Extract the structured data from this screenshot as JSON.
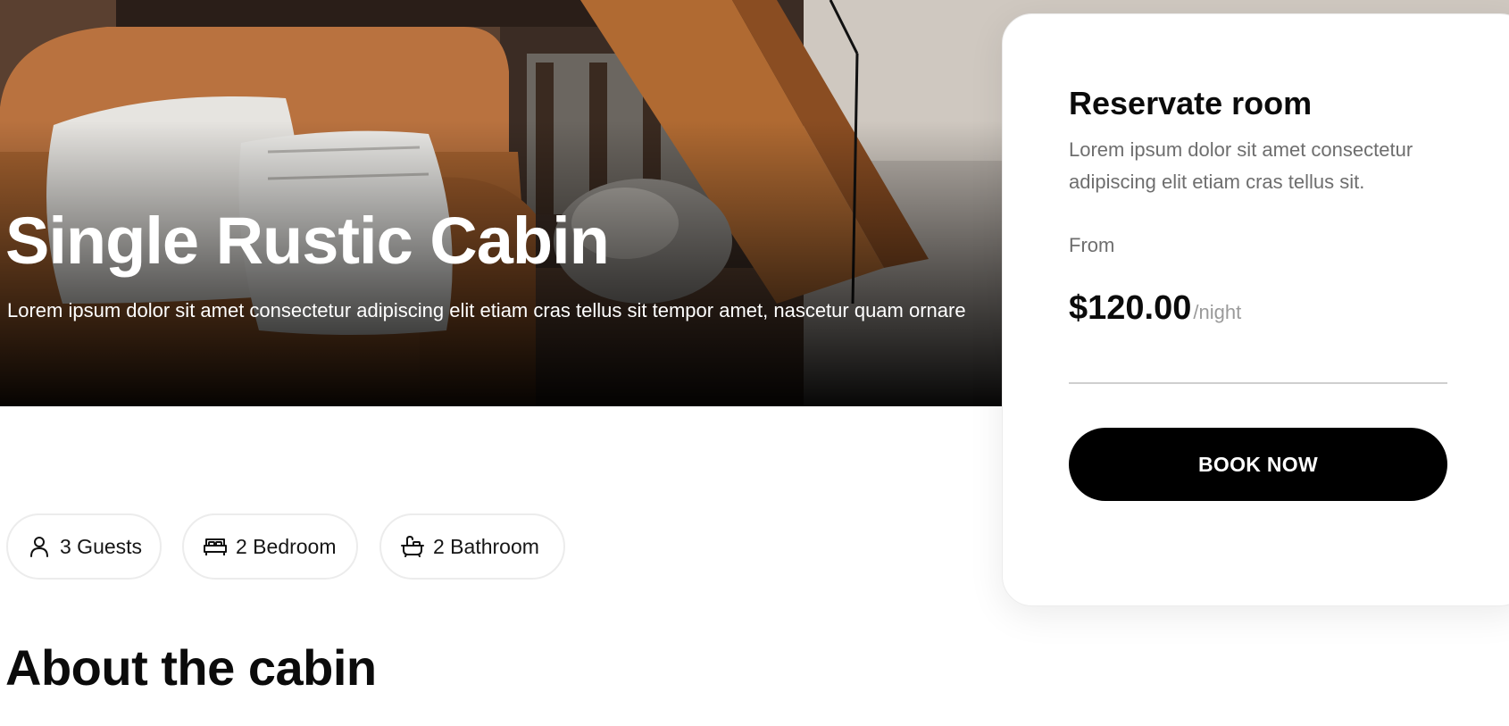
{
  "hero": {
    "title": "Single Rustic Cabin",
    "subtitle": "Lorem ipsum dolor sit amet consectetur adipiscing elit etiam cras tellus sit tempor amet, nascetur quam ornare"
  },
  "booking": {
    "title": "Reservate room",
    "description": "Lorem ipsum dolor sit amet consectetur adipiscing elit etiam cras tellus sit.",
    "from_label": "From",
    "price": "$120.00",
    "price_unit": "/night",
    "button_label": "BOOK NOW"
  },
  "amenities": [
    {
      "icon": "person-icon",
      "label": "3 Guests"
    },
    {
      "icon": "bed-icon",
      "label": "2 Bedroom"
    },
    {
      "icon": "bathtub-icon",
      "label": "2 Bathroom"
    }
  ],
  "about": {
    "heading": "About the cabin"
  },
  "colors": {
    "button_bg": "#000000",
    "button_text": "#ffffff",
    "muted_text": "#6e6e6e",
    "chip_border": "#ececec"
  }
}
